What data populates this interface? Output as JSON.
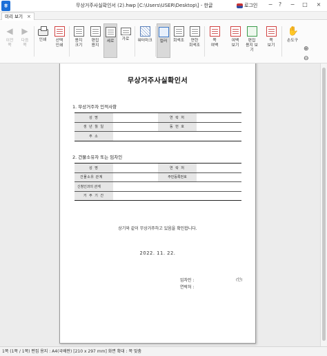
{
  "titlebar": {
    "app_icon": "hwp-app-icon",
    "title": "무상거주사실확인서 (2).hwp [C:\\Users\\USER\\Desktop\\] - 한글",
    "login": "로그인",
    "controls": [
      "−",
      "?",
      "−",
      "□",
      "×"
    ]
  },
  "tab": {
    "label": "미리 보기",
    "close": "×"
  },
  "ribbon": {
    "items": [
      {
        "label": "이전\n쪽",
        "icon": "prev-page-icon"
      },
      {
        "label": "다음\n쪽",
        "icon": "next-page-icon"
      },
      {
        "label": "인쇄",
        "icon": "printer-icon"
      },
      {
        "label": "선택\n인쇄",
        "icon": "select-print-icon"
      },
      {
        "label": "용지\n크기",
        "icon": "paper-size-icon"
      },
      {
        "label": "편집\n용지",
        "icon": "edit-paper-icon"
      },
      {
        "label": "세로",
        "icon": "portrait-icon"
      },
      {
        "label": "가로",
        "icon": "landscape-icon"
      },
      {
        "label": "워터마크",
        "icon": "watermark-icon"
      },
      {
        "label": "컬러",
        "icon": "color-icon"
      },
      {
        "label": "회색조",
        "icon": "grayscale-icon"
      },
      {
        "label": "연한\n회색조",
        "icon": "light-grayscale-icon"
      },
      {
        "label": "쪽\n여백",
        "icon": "page-margin-icon"
      },
      {
        "label": "여백\n보기",
        "icon": "show-margin-icon"
      },
      {
        "label": "편집\n용지 보기",
        "icon": "show-edit-paper-icon"
      },
      {
        "label": "쪽\n보기",
        "icon": "page-view-icon"
      },
      {
        "label": "손도구",
        "icon": "hand-tool-icon"
      }
    ],
    "zoom": {
      "in": "⊕",
      "out": "⊖",
      "more": "⌄"
    }
  },
  "document": {
    "title": "무상거주사실확인서",
    "section1": "1. 무상거주자 인적사항",
    "table1": [
      [
        "성        명",
        "",
        "연 락 처",
        ""
      ],
      [
        "생 년 월 일",
        "",
        "동 번 호",
        ""
      ],
      [
        "주       소",
        ""
      ]
    ],
    "section2": "2. 건물소유자 또는 임차인",
    "table2": [
      [
        "성        명",
        "",
        "연 락 처",
        ""
      ],
      [
        "건물소유 관계",
        "",
        "주민등록번호",
        ""
      ],
      [
        "신청인과의 관계",
        ""
      ],
      [
        "거 주 기 간",
        ""
      ]
    ],
    "confirm_text": "상기와 같이 무상거주하고 있음을 확인합니다.",
    "date": "2022.  11.  22.",
    "signer_label": "임차인 :",
    "seal": "(인)",
    "contact_label": "연락처 :"
  },
  "statusbar": {
    "text": "1쪽 (1쪽 / 1쪽)   편집 용지 : A4(국배판) [210 x 297 mm]   화면 확대 : 쪽 맞춤"
  }
}
